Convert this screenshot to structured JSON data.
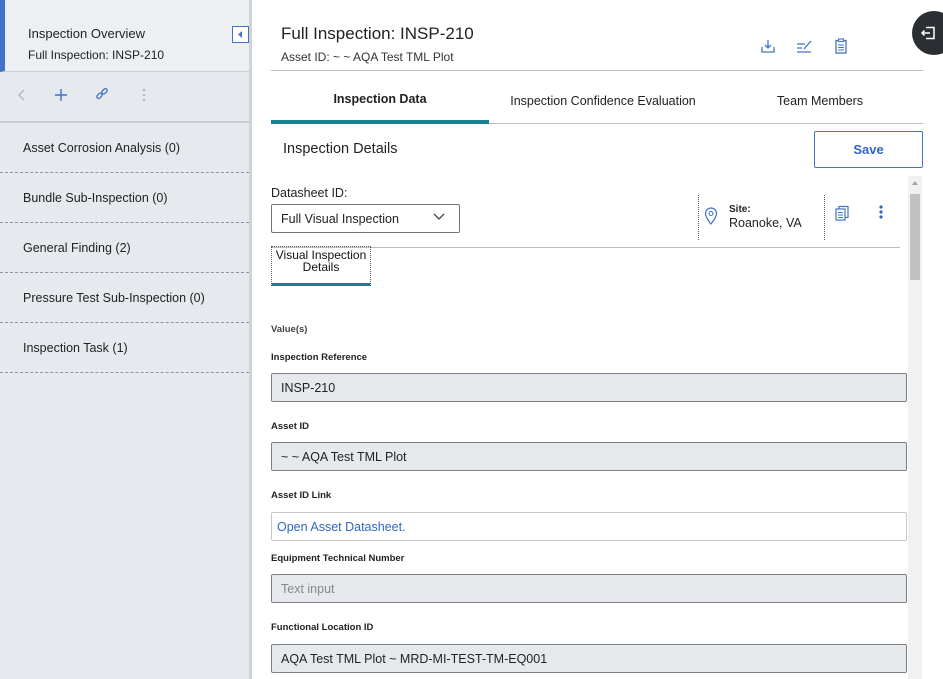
{
  "sidebar": {
    "title": "Inspection Overview",
    "subtitle": "Full Inspection: INSP-210",
    "items": [
      {
        "label": "Asset Corrosion Analysis (0)"
      },
      {
        "label": "Bundle Sub-Inspection (0)"
      },
      {
        "label": "General Finding (2)"
      },
      {
        "label": "Pressure Test Sub-Inspection (0)"
      },
      {
        "label": "Inspection Task (1)"
      }
    ],
    "toolbar_icons": [
      "back-icon",
      "plus-icon",
      "link-icon",
      "more-vertical-icon"
    ]
  },
  "header": {
    "title": "Full Inspection: INSP-210",
    "subtitle": "Asset ID: ~ ~ AQA Test TML Plot",
    "icons": [
      "download-icon",
      "edit-lines-icon",
      "clipboard-icon"
    ]
  },
  "tabs": [
    {
      "label": "Inspection Data",
      "active": true
    },
    {
      "label": "Inspection Confidence Evaluation",
      "active": false
    },
    {
      "label": "Team Members",
      "active": false
    }
  ],
  "details": {
    "section_title": "Inspection Details",
    "save_label": "Save",
    "datasheet_label": "Datasheet ID:",
    "datasheet_value": "Full Visual Inspection",
    "site_label": "Site:",
    "site_value": "Roanoke, VA",
    "subtab_label": "Visual Inspection Details",
    "values_label": "Value(s)"
  },
  "fields": {
    "inspection_reference": {
      "label": "Inspection Reference",
      "value": "INSP-210"
    },
    "asset_id": {
      "label": "Asset ID",
      "value": "~ ~ AQA Test TML Plot"
    },
    "asset_id_link": {
      "label": "Asset ID Link",
      "value": "Open Asset Datasheet."
    },
    "equipment_technical_number": {
      "label": "Equipment Technical Number",
      "placeholder": "Text input"
    },
    "functional_location_id": {
      "label": "Functional Location ID",
      "value": "AQA Test TML Plot ~ MRD-MI-TEST-TM-EQ001"
    }
  },
  "colors": {
    "accent_blue": "#3f74c6",
    "tab_teal": "#1a7f91",
    "sidebar_bg": "#e6e9ed",
    "field_bg": "#e6e9ec"
  }
}
